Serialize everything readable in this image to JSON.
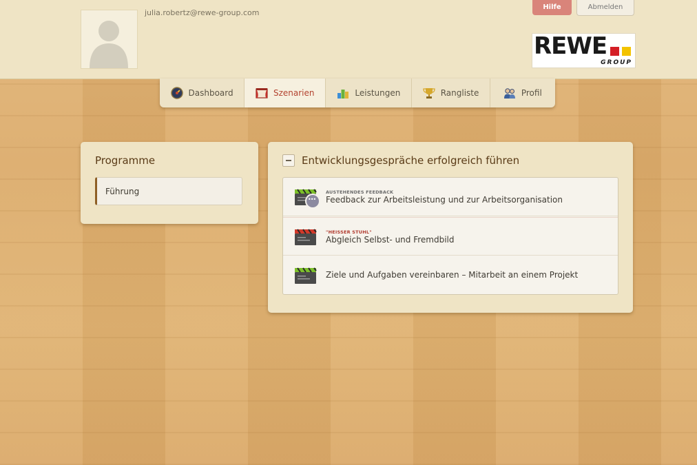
{
  "header": {
    "user_email": "julia.robertz@rewe-group.com",
    "help_label": "Hilfe",
    "logout_label": "Abmelden",
    "logo": {
      "word": "REWE",
      "sub": "GROUP",
      "colors": [
        "#d41f26",
        "#f3c300"
      ]
    }
  },
  "tabs": [
    {
      "label": "Dashboard",
      "icon": "dashboard-gauge-icon",
      "active": false
    },
    {
      "label": "Szenarien",
      "icon": "theater-stage-icon",
      "active": true
    },
    {
      "label": "Leistungen",
      "icon": "bar-chart-icon",
      "active": false
    },
    {
      "label": "Rangliste",
      "icon": "trophy-icon",
      "active": false
    },
    {
      "label": "Profil",
      "icon": "people-icon",
      "active": false
    }
  ],
  "programs": {
    "title": "Programme",
    "items": [
      {
        "label": "Führung",
        "selected": true
      }
    ]
  },
  "scenarios": {
    "title": "Entwicklungsgespräche erfolgreich führen",
    "items": [
      {
        "badge": "AUSTEHENDES FEEDBACK",
        "badge_color": "#6b6b6b",
        "title": "Feedback zur Arbeitsleistung und zur Arbeitsorganisation",
        "clapper_color": "#7cc02a",
        "pending": true
      },
      {
        "badge": "\"HEISSER STUHL\"",
        "badge_color": "#b03a2e",
        "title": "Abgleich Selbst- und Fremdbild",
        "clapper_color": "#d23a2a",
        "pending": false
      },
      {
        "badge": "",
        "badge_color": "#6b6b6b",
        "title": "Ziele und Aufgaben vereinbaren – Mitarbeit an einem Projekt",
        "clapper_color": "#7cc02a",
        "pending": false
      }
    ]
  },
  "colors": {
    "accent": "#b3422f",
    "panel": "#efe4c5",
    "help_button": "#d9847a"
  }
}
